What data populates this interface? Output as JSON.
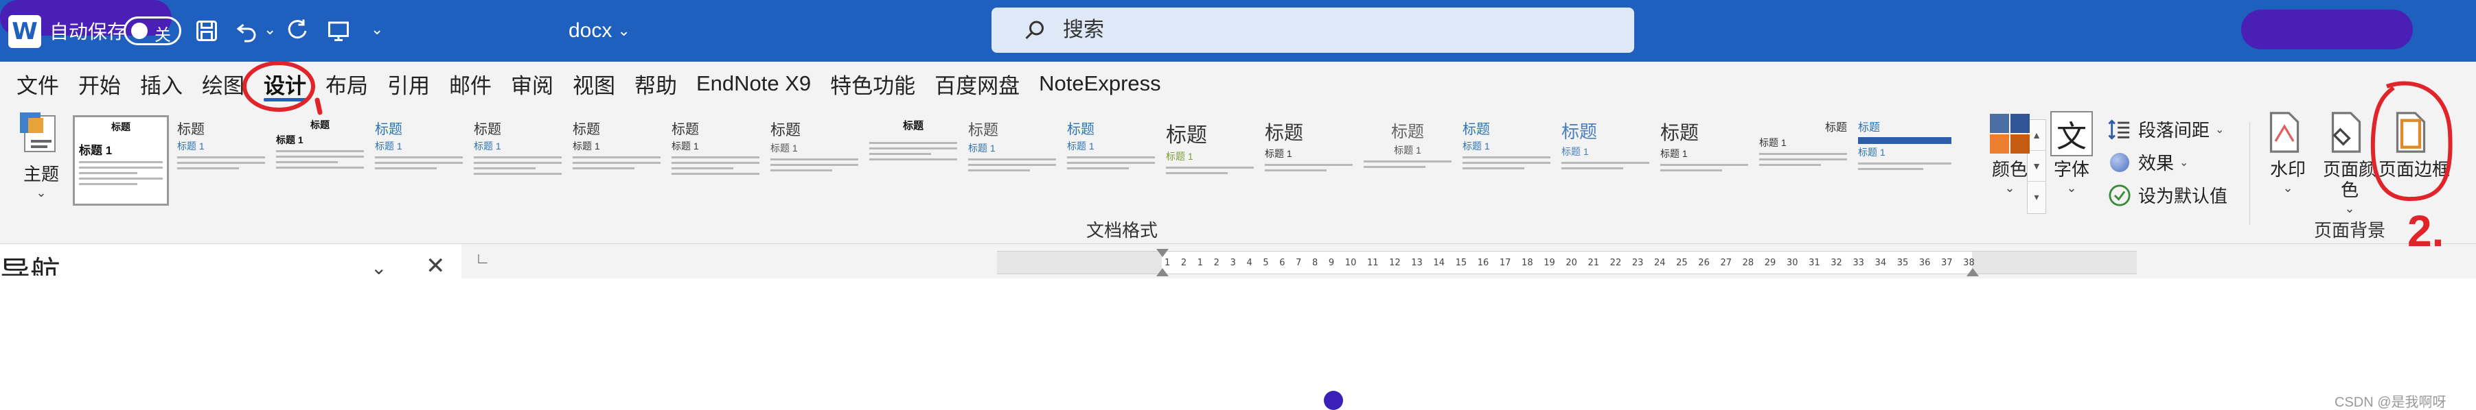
{
  "titlebar": {
    "app_icon": "word-icon",
    "autosave_label": "自动保存",
    "autosave_state": "关",
    "filename": "docx",
    "search_placeholder": "搜索",
    "bg_color": "#1f5fbe"
  },
  "tabs": [
    {
      "label": "文件"
    },
    {
      "label": "开始"
    },
    {
      "label": "插入"
    },
    {
      "label": "绘图"
    },
    {
      "label": "设计",
      "active": true
    },
    {
      "label": "布局"
    },
    {
      "label": "引用"
    },
    {
      "label": "邮件"
    },
    {
      "label": "审阅"
    },
    {
      "label": "视图"
    },
    {
      "label": "帮助"
    },
    {
      "label": "EndNote X9"
    },
    {
      "label": "特色功能"
    },
    {
      "label": "百度网盘"
    },
    {
      "label": "NoteExpress"
    }
  ],
  "ribbon": {
    "theme": {
      "label": "主题"
    },
    "document_formatting_label": "文档格式",
    "style_set": {
      "first_title": "标题",
      "first_heading": "标题 1",
      "heading": "标题",
      "heading_1": "标题 1"
    },
    "colors": {
      "label": "颜色"
    },
    "fonts": {
      "label": "字体"
    },
    "paragraph_spacing": {
      "label": "段落间距"
    },
    "effects": {
      "label": "效果"
    },
    "set_as_default": {
      "label": "设为默认值"
    },
    "watermark": {
      "label": "水印"
    },
    "page_color": {
      "label": "页面颜色"
    },
    "page_borders": {
      "label": "页面边框"
    },
    "page_background_label": "页面背景"
  },
  "navigation": {
    "title": "导航"
  },
  "ruler": {
    "marks": [
      "1",
      "2",
      "1",
      "2",
      "3",
      "4",
      "5",
      "6",
      "7",
      "8",
      "9",
      "10",
      "11",
      "12",
      "13",
      "14",
      "15",
      "16",
      "17",
      "18",
      "19",
      "20",
      "21",
      "22",
      "23",
      "24",
      "25",
      "26",
      "27",
      "28",
      "29",
      "30",
      "31",
      "32",
      "33",
      "34",
      "35",
      "36",
      "37",
      "38"
    ]
  },
  "annotations": {
    "step2": "2."
  },
  "watermark_text": "CSDN @是我啊呀"
}
